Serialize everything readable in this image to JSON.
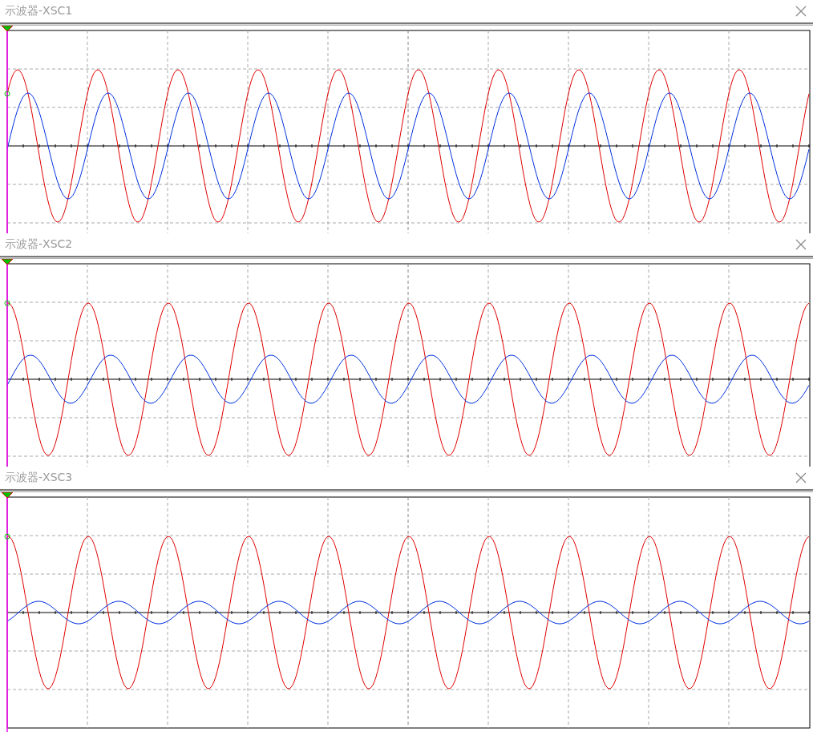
{
  "scopes": [
    {
      "title": "示波器-XSC1"
    },
    {
      "title": "示波器-XSC2"
    },
    {
      "title": "示波器-XSC3"
    }
  ]
}
